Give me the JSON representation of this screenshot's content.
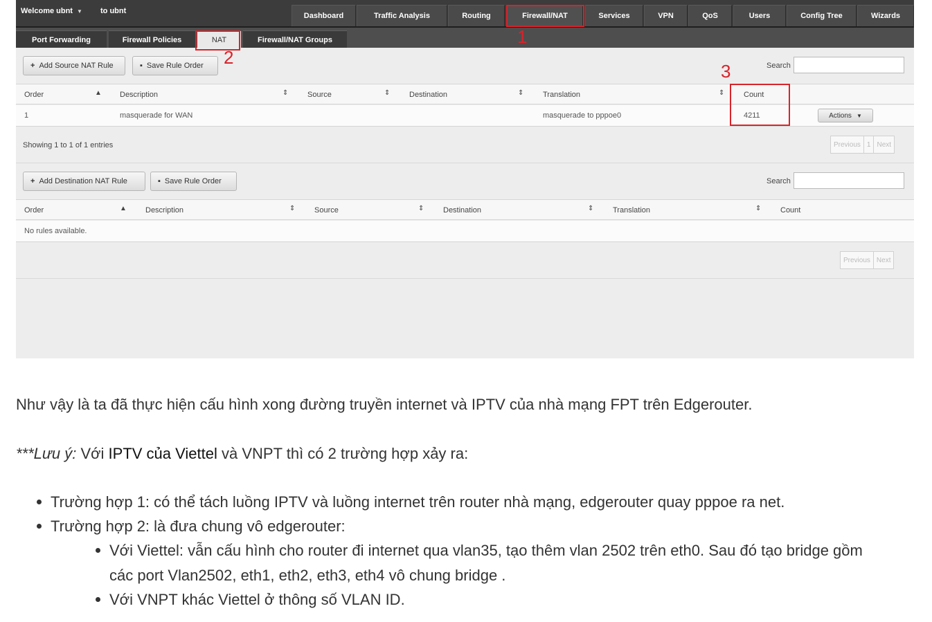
{
  "topbar": {
    "welcome": "Welcome ubnt",
    "to": "to ubnt",
    "nav": [
      "Dashboard",
      "Traffic Analysis",
      "Routing",
      "Firewall/NAT",
      "Services",
      "VPN",
      "QoS",
      "Users",
      "Config Tree",
      "Wizards"
    ]
  },
  "subtabs": [
    "Port Forwarding",
    "Firewall Policies",
    "NAT",
    "Firewall/NAT Groups"
  ],
  "annotations": [
    "1",
    "2",
    "3"
  ],
  "source_nat": {
    "add_button": "Add Source NAT Rule",
    "save_button": "Save Rule Order",
    "search_label": "Search",
    "headers": [
      "Order",
      "Description",
      "Source",
      "Destination",
      "Translation",
      "Count"
    ],
    "rows": [
      {
        "order": "1",
        "description": "masquerade for WAN",
        "translation": "masquerade to pppoe0",
        "count": "4211",
        "actions": "Actions"
      }
    ],
    "info": "Showing 1 to 1 of 1 entries",
    "pager": [
      "Previous",
      "1",
      "Next"
    ]
  },
  "dest_nat": {
    "add_button": "Add Destination NAT Rule",
    "save_button": "Save Rule Order",
    "search_label": "Search",
    "headers": [
      "Order",
      "Description",
      "Source",
      "Destination",
      "Translation",
      "Count"
    ],
    "empty": "No rules available.",
    "pager": [
      "Previous",
      "Next"
    ]
  },
  "article": {
    "p1": "Như vậy là ta đã thực hiện cấu hình xong đường truyền internet và IPTV của nhà mạng FPT trên Edgerouter.",
    "note_label": "***Lưu ý:",
    "note_rest": " Với ",
    "note_link": "IPTV của Viettel",
    "note_tail": " và VNPT thì có 2 trường hợp xảy ra:",
    "b1": "Trường hợp 1: có thể tách luồng IPTV và luồng internet trên router nhà mạng, edgerouter quay pppoe ra net.",
    "b2": "Trường hợp 2: là đưa chung vô edgerouter:",
    "b2a_line1": "Với Viettel: vẫn cấu hình cho router đi internet qua vlan35, tạo thêm vlan 2502 trên eth0. Sau đó tạo bridge gồm",
    "b2a_line2": "các port Vlan2502, eth1, eth2, eth3, eth4 vô chung bridge .",
    "b2b": "Với VNPT khác Viettel ở thông số VLAN ID."
  }
}
